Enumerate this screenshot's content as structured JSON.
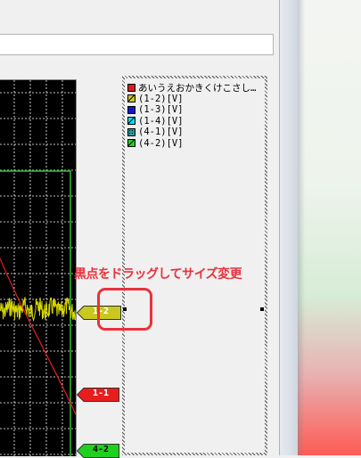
{
  "annotation": "黒点をドラッグしてサイズ変更",
  "legend": {
    "items": [
      {
        "label": "あいうえおかきくけこさし…",
        "color": "#d42020",
        "pattern": "solid"
      },
      {
        "label": "(1-2)[V]",
        "color": "#c8c81e",
        "pattern": "slash"
      },
      {
        "label": "(1-3)[V]",
        "color": "#1414c8",
        "pattern": "solid"
      },
      {
        "label": "(1-4)[V]",
        "color": "#00e0ff",
        "pattern": "slash"
      },
      {
        "label": "(4-1)[V]",
        "color": "#20a0a0",
        "pattern": "dotted"
      },
      {
        "label": "(4-2)[V]",
        "color": "#20d020",
        "pattern": "slash"
      }
    ]
  },
  "markers": [
    {
      "label": "1-2",
      "fill": "#c8c81e",
      "text_color": "#ffffff"
    },
    {
      "label": "1-1",
      "fill": "#e81e1e",
      "text_color": "#ffffff"
    },
    {
      "label": "4-2",
      "fill": "#20d020",
      "text_color": "#000000"
    }
  ],
  "colors": {
    "trace_yellow": "#d8d800",
    "trace_green": "#30c030",
    "trace_red": "#e02020",
    "grid": "#ffffff",
    "annotation": "#e8323c"
  }
}
